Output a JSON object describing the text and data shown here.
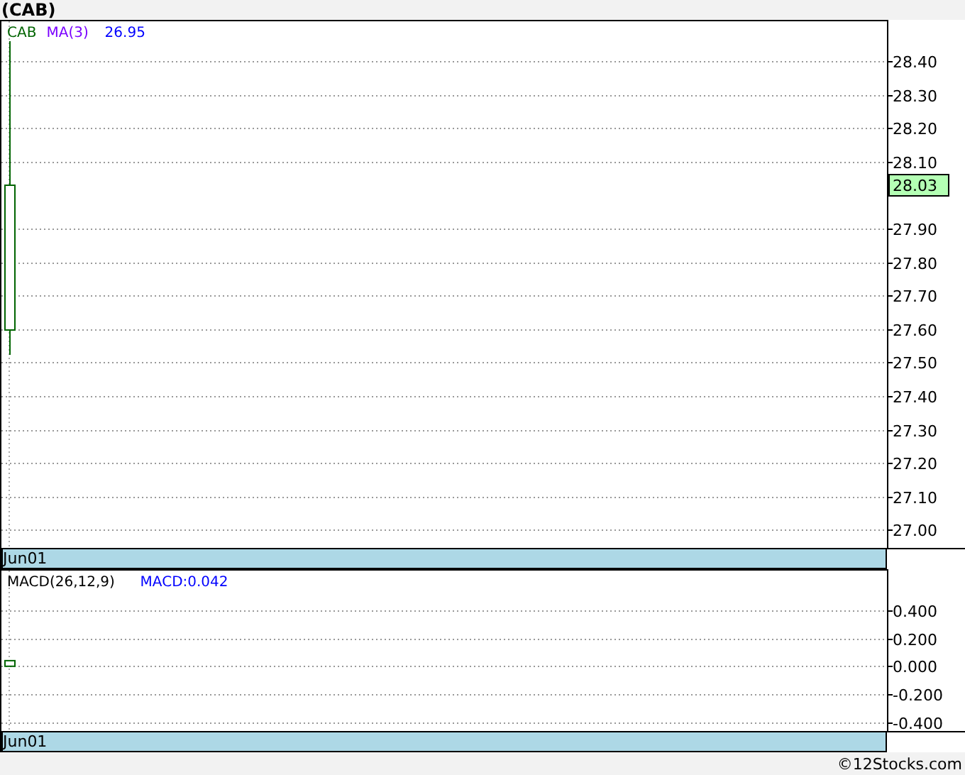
{
  "title": "(CAB)",
  "price_panel": {
    "legend": [
      {
        "text": "CAB",
        "color": "#006400"
      },
      {
        "text": "MA(3)",
        "color": "#7a00ff"
      },
      {
        "text": "26.95",
        "color": "#0000ff"
      }
    ],
    "current_price": "28.03",
    "axis_labels": [
      "28.40",
      "28.30",
      "28.20",
      "28.10",
      "27.90",
      "27.80",
      "27.70",
      "27.60",
      "27.50",
      "27.40",
      "27.30",
      "27.20",
      "27.10",
      "27.00"
    ],
    "date_label": "Jun01"
  },
  "macd_panel": {
    "legend": [
      {
        "text": "MACD(26,12,9)",
        "color": "#000000"
      },
      {
        "text": "MACD:0.042",
        "color": "#0000ff"
      }
    ],
    "chart_data": {
      "type": "bar",
      "series": [
        {
          "color": "#006400",
          "values": [
            0.04
          ]
        }
      ],
      "ylim": [
        -0.46,
        0.69
      ],
      "grid": true,
      "yticks": [
        {
          "value": 0.4,
          "label": "0.400"
        },
        {
          "value": 0.2,
          "label": "0.200"
        },
        {
          "value": 0,
          "label": "0.000"
        },
        {
          "value": -0.2,
          "label": "-0.200"
        },
        {
          "value": -0.4,
          "label": "-0.400"
        }
      ]
    },
    "date_label": "Jun01"
  },
  "footer": "©12Stocks.com"
}
